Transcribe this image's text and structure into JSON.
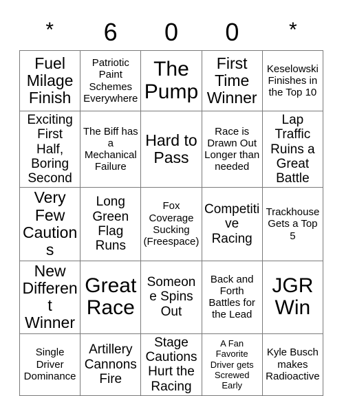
{
  "header": {
    "letters": [
      "*",
      "6",
      "0",
      "0",
      "*"
    ]
  },
  "grid": {
    "rows": [
      [
        {
          "text": "Fuel Milage Finish",
          "size": "lg"
        },
        {
          "text": "Patriotic Paint Schemes Everywhere",
          "size": "sm"
        },
        {
          "text": "The Pump",
          "size": "xl"
        },
        {
          "text": "First Time Winner",
          "size": "lg"
        },
        {
          "text": "Keselowski Finishes in the Top 10",
          "size": "sm"
        }
      ],
      [
        {
          "text": "Exciting First Half, Boring Second",
          "size": "md"
        },
        {
          "text": "The Biff has a Mechanical Failure",
          "size": "sm"
        },
        {
          "text": "Hard to Pass",
          "size": "lg"
        },
        {
          "text": "Race is Drawn Out Longer than needed",
          "size": "sm"
        },
        {
          "text": "Lap Traffic Ruins a Great Battle",
          "size": "md"
        }
      ],
      [
        {
          "text": "Very Few Cautions",
          "size": "lg"
        },
        {
          "text": "Long Green Flag Runs",
          "size": "md"
        },
        {
          "text": "Fox Coverage Sucking (Freespace)",
          "size": "sm"
        },
        {
          "text": "Competitive Racing",
          "size": "md"
        },
        {
          "text": "Trackhouse Gets a Top 5",
          "size": "sm"
        }
      ],
      [
        {
          "text": "New Different Winner",
          "size": "lg"
        },
        {
          "text": "Great Race",
          "size": "xl"
        },
        {
          "text": "Someone Spins Out",
          "size": "md"
        },
        {
          "text": "Back and Forth Battles for the Lead",
          "size": "sm"
        },
        {
          "text": "JGR Win",
          "size": "xl"
        }
      ],
      [
        {
          "text": "Single Driver Dominance",
          "size": "sm"
        },
        {
          "text": "Artillery Cannons Fire",
          "size": "md"
        },
        {
          "text": "Stage Cautions Hurt the Racing",
          "size": "md"
        },
        {
          "text": "A Fan Favorite Driver gets Screwed Early",
          "size": "xs"
        },
        {
          "text": "Kyle Busch makes Radioactive",
          "size": "sm"
        }
      ]
    ]
  },
  "colors": {
    "border": "#7a7a7a",
    "text": "#000000",
    "background": "#ffffff"
  }
}
